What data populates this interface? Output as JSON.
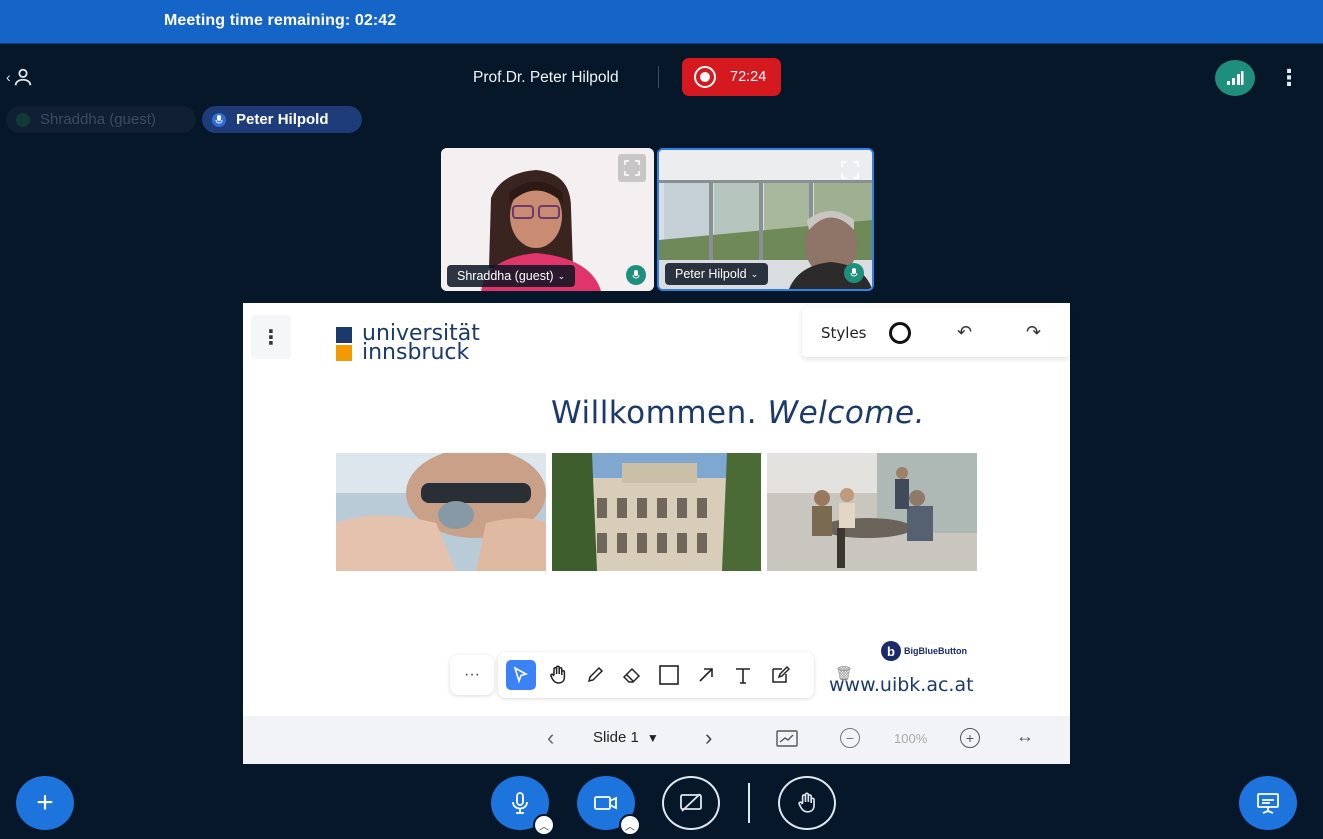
{
  "banner": {
    "text": "Meeting time remaining: 02:42"
  },
  "header": {
    "meeting_title": "Prof.Dr. Peter Hilpold",
    "recording_time": "72:24"
  },
  "talkers": [
    {
      "name": "Shraddha (guest)"
    },
    {
      "name": "Peter Hilpold"
    }
  ],
  "videos": [
    {
      "name": "Shraddha (guest)"
    },
    {
      "name": "Peter Hilpold"
    }
  ],
  "slide": {
    "logo_line1": "universität",
    "logo_line2": "innsbruck",
    "welcome_regular": "Willkommen. ",
    "welcome_italic": "Welcome.",
    "bbb_text": "BigBlueButton",
    "url": "www.uibk.ac.at"
  },
  "styles_panel": {
    "label": "Styles"
  },
  "slide_bar": {
    "slide_label": "Slide 1",
    "zoom": "100%"
  },
  "colors": {
    "background": "#06172a",
    "banner": "#1565c8",
    "recording": "#d6181f",
    "primary_button": "#1c74dc",
    "tool_selected": "#3b82f6"
  }
}
